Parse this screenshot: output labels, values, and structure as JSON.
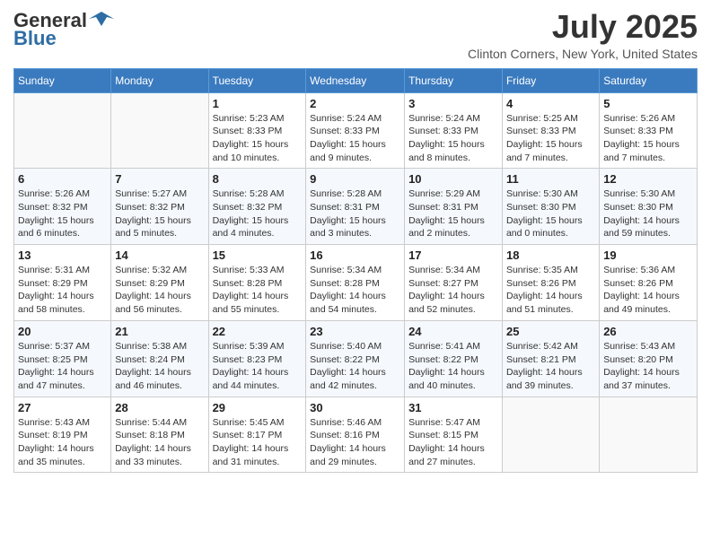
{
  "logo": {
    "general": "General",
    "blue": "Blue"
  },
  "header": {
    "month": "July 2025",
    "location": "Clinton Corners, New York, United States"
  },
  "weekdays": [
    "Sunday",
    "Monday",
    "Tuesday",
    "Wednesday",
    "Thursday",
    "Friday",
    "Saturday"
  ],
  "weeks": [
    [
      {
        "day": "",
        "info": ""
      },
      {
        "day": "",
        "info": ""
      },
      {
        "day": "1",
        "info": "Sunrise: 5:23 AM\nSunset: 8:33 PM\nDaylight: 15 hours and 10 minutes."
      },
      {
        "day": "2",
        "info": "Sunrise: 5:24 AM\nSunset: 8:33 PM\nDaylight: 15 hours and 9 minutes."
      },
      {
        "day": "3",
        "info": "Sunrise: 5:24 AM\nSunset: 8:33 PM\nDaylight: 15 hours and 8 minutes."
      },
      {
        "day": "4",
        "info": "Sunrise: 5:25 AM\nSunset: 8:33 PM\nDaylight: 15 hours and 7 minutes."
      },
      {
        "day": "5",
        "info": "Sunrise: 5:26 AM\nSunset: 8:33 PM\nDaylight: 15 hours and 7 minutes."
      }
    ],
    [
      {
        "day": "6",
        "info": "Sunrise: 5:26 AM\nSunset: 8:32 PM\nDaylight: 15 hours and 6 minutes."
      },
      {
        "day": "7",
        "info": "Sunrise: 5:27 AM\nSunset: 8:32 PM\nDaylight: 15 hours and 5 minutes."
      },
      {
        "day": "8",
        "info": "Sunrise: 5:28 AM\nSunset: 8:32 PM\nDaylight: 15 hours and 4 minutes."
      },
      {
        "day": "9",
        "info": "Sunrise: 5:28 AM\nSunset: 8:31 PM\nDaylight: 15 hours and 3 minutes."
      },
      {
        "day": "10",
        "info": "Sunrise: 5:29 AM\nSunset: 8:31 PM\nDaylight: 15 hours and 2 minutes."
      },
      {
        "day": "11",
        "info": "Sunrise: 5:30 AM\nSunset: 8:30 PM\nDaylight: 15 hours and 0 minutes."
      },
      {
        "day": "12",
        "info": "Sunrise: 5:30 AM\nSunset: 8:30 PM\nDaylight: 14 hours and 59 minutes."
      }
    ],
    [
      {
        "day": "13",
        "info": "Sunrise: 5:31 AM\nSunset: 8:29 PM\nDaylight: 14 hours and 58 minutes."
      },
      {
        "day": "14",
        "info": "Sunrise: 5:32 AM\nSunset: 8:29 PM\nDaylight: 14 hours and 56 minutes."
      },
      {
        "day": "15",
        "info": "Sunrise: 5:33 AM\nSunset: 8:28 PM\nDaylight: 14 hours and 55 minutes."
      },
      {
        "day": "16",
        "info": "Sunrise: 5:34 AM\nSunset: 8:28 PM\nDaylight: 14 hours and 54 minutes."
      },
      {
        "day": "17",
        "info": "Sunrise: 5:34 AM\nSunset: 8:27 PM\nDaylight: 14 hours and 52 minutes."
      },
      {
        "day": "18",
        "info": "Sunrise: 5:35 AM\nSunset: 8:26 PM\nDaylight: 14 hours and 51 minutes."
      },
      {
        "day": "19",
        "info": "Sunrise: 5:36 AM\nSunset: 8:26 PM\nDaylight: 14 hours and 49 minutes."
      }
    ],
    [
      {
        "day": "20",
        "info": "Sunrise: 5:37 AM\nSunset: 8:25 PM\nDaylight: 14 hours and 47 minutes."
      },
      {
        "day": "21",
        "info": "Sunrise: 5:38 AM\nSunset: 8:24 PM\nDaylight: 14 hours and 46 minutes."
      },
      {
        "day": "22",
        "info": "Sunrise: 5:39 AM\nSunset: 8:23 PM\nDaylight: 14 hours and 44 minutes."
      },
      {
        "day": "23",
        "info": "Sunrise: 5:40 AM\nSunset: 8:22 PM\nDaylight: 14 hours and 42 minutes."
      },
      {
        "day": "24",
        "info": "Sunrise: 5:41 AM\nSunset: 8:22 PM\nDaylight: 14 hours and 40 minutes."
      },
      {
        "day": "25",
        "info": "Sunrise: 5:42 AM\nSunset: 8:21 PM\nDaylight: 14 hours and 39 minutes."
      },
      {
        "day": "26",
        "info": "Sunrise: 5:43 AM\nSunset: 8:20 PM\nDaylight: 14 hours and 37 minutes."
      }
    ],
    [
      {
        "day": "27",
        "info": "Sunrise: 5:43 AM\nSunset: 8:19 PM\nDaylight: 14 hours and 35 minutes."
      },
      {
        "day": "28",
        "info": "Sunrise: 5:44 AM\nSunset: 8:18 PM\nDaylight: 14 hours and 33 minutes."
      },
      {
        "day": "29",
        "info": "Sunrise: 5:45 AM\nSunset: 8:17 PM\nDaylight: 14 hours and 31 minutes."
      },
      {
        "day": "30",
        "info": "Sunrise: 5:46 AM\nSunset: 8:16 PM\nDaylight: 14 hours and 29 minutes."
      },
      {
        "day": "31",
        "info": "Sunrise: 5:47 AM\nSunset: 8:15 PM\nDaylight: 14 hours and 27 minutes."
      },
      {
        "day": "",
        "info": ""
      },
      {
        "day": "",
        "info": ""
      }
    ]
  ]
}
